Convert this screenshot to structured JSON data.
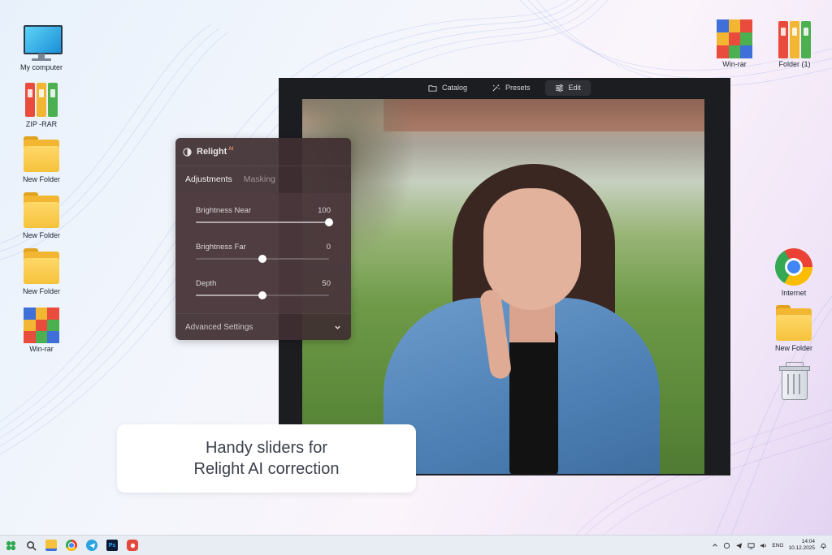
{
  "desktop": {
    "icons_left": [
      {
        "label": "My computer",
        "icon": "monitor-icon"
      },
      {
        "label": "ZIP -RAR",
        "icon": "binders-icon"
      },
      {
        "label": "New Folder",
        "icon": "folder-icon"
      },
      {
        "label": "New Folder",
        "icon": "folder-icon"
      },
      {
        "label": "New Folder",
        "icon": "folder-icon"
      },
      {
        "label": "Win-rar",
        "icon": "winrar-icon"
      }
    ],
    "icons_right_top": [
      {
        "label": "Win-rar",
        "icon": "winrar-icon"
      },
      {
        "label": "Folder (1)",
        "icon": "binders-icon"
      }
    ],
    "icons_right": [
      {
        "label": "Internet",
        "icon": "chrome-icon"
      },
      {
        "label": "New Folder",
        "icon": "folder-icon"
      },
      {
        "label": "",
        "icon": "recycle-bin-icon"
      }
    ]
  },
  "editor": {
    "tabs": [
      {
        "label": "Catalog",
        "icon": "folder-outline-icon"
      },
      {
        "label": "Presets",
        "icon": "sparkle-icon"
      },
      {
        "label": "Edit",
        "icon": "sliders-icon",
        "active": true
      }
    ]
  },
  "relight_panel": {
    "title": "Relight",
    "badge": "AI",
    "tabs": [
      "Adjustments",
      "Masking"
    ],
    "sliders": [
      {
        "name": "Brightness Near",
        "value": "100",
        "fraction": 1.0
      },
      {
        "name": "Brightness Far",
        "value": "0",
        "fraction": 0.5
      },
      {
        "name": "Depth",
        "value": "50",
        "fraction": 0.5
      }
    ],
    "advanced_label": "Advanced Settings"
  },
  "caption": {
    "line1": "Handy sliders for",
    "line2": "Relight AI correction"
  },
  "taskbar": {
    "lang": "ENG",
    "time": "14:04",
    "date": "10.12.2025"
  },
  "colors": {
    "accent_orange": "#e9976a",
    "panel_bg": "#402e32",
    "folder_yellow": "#f6c23b"
  }
}
